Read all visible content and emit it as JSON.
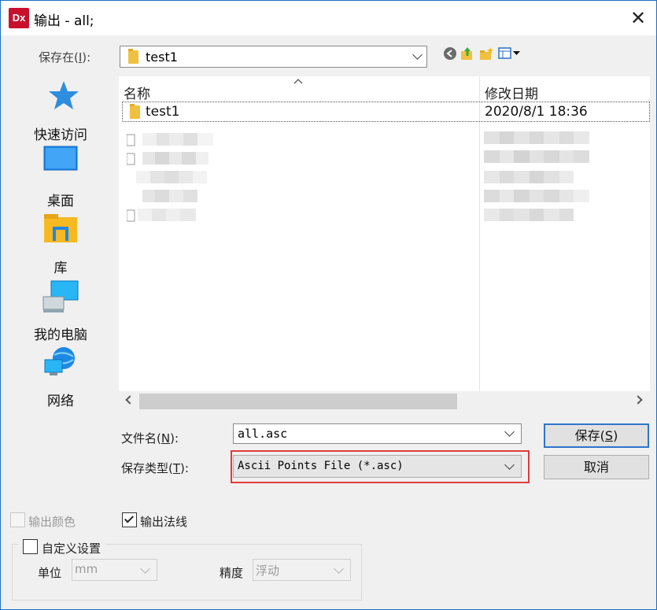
{
  "window": {
    "title": "输出 - all;",
    "app_icon_text": "Dx"
  },
  "save_in": {
    "label": "保存在(",
    "hotkey": "I",
    "label_end": "):",
    "value": "test1"
  },
  "toolbar": {
    "icons": [
      "back-icon",
      "up-folder-icon",
      "new-folder-icon",
      "view-menu-icon"
    ]
  },
  "places": [
    {
      "id": "quick-access",
      "label": "快速访问",
      "icon": "star-icon"
    },
    {
      "id": "desktop",
      "label": "桌面",
      "icon": "desktop-icon"
    },
    {
      "id": "library",
      "label": "库",
      "icon": "library-icon"
    },
    {
      "id": "this-pc",
      "label": "我的电脑",
      "icon": "computer-icon"
    },
    {
      "id": "network",
      "label": "网络",
      "icon": "network-icon"
    }
  ],
  "file_list": {
    "columns": [
      "名称",
      "修改日期"
    ],
    "rows": [
      {
        "name": "test1",
        "modified": "2020/8/1 18:36",
        "type": "folder"
      }
    ]
  },
  "filename": {
    "label": "文件名(",
    "hotkey": "N",
    "label_end": "):",
    "value": "all.asc"
  },
  "filetype": {
    "label": "保存类型(",
    "hotkey": "T",
    "label_end": "):",
    "value": "Ascii Points File (*.asc)"
  },
  "buttons": {
    "save": "保存(",
    "save_hotkey": "S",
    "save_end": ")",
    "cancel": "取消"
  },
  "options": {
    "output_color": {
      "label": "输出颜色",
      "checked": false,
      "enabled": false
    },
    "output_normals": {
      "label": "输出法线",
      "checked": true,
      "enabled": true
    },
    "custom_settings": {
      "label": "自定义设置",
      "checked": false
    },
    "unit": {
      "label": "单位",
      "value": "mm"
    },
    "precision": {
      "label": "精度",
      "value": "浮动"
    }
  }
}
